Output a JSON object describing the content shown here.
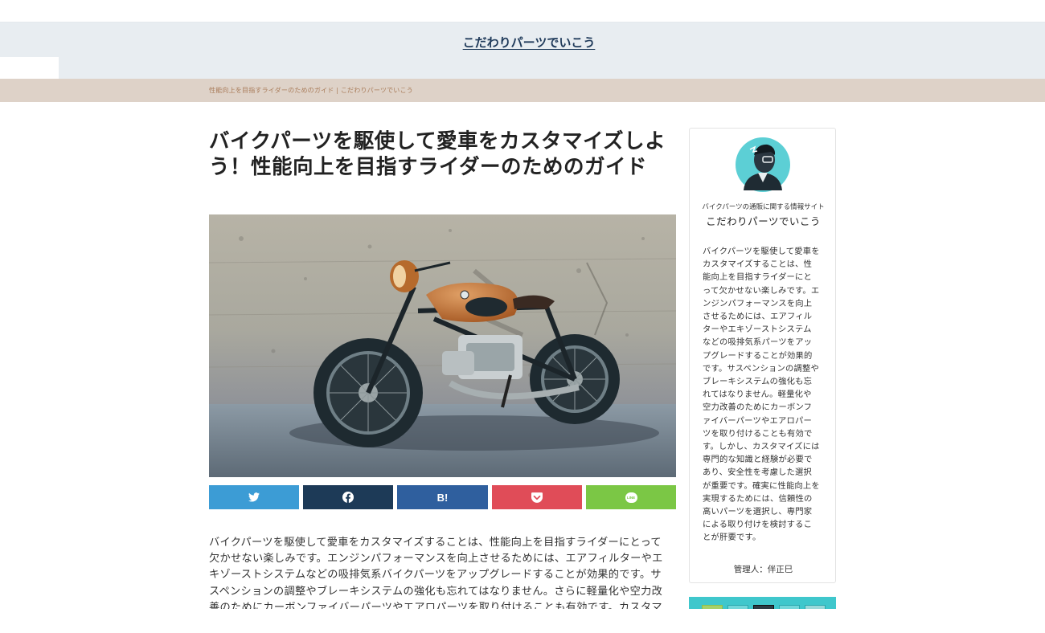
{
  "site": {
    "title": "こだわりパーツでいこう"
  },
  "breadcrumb": {
    "text": "性能向上を目指すライダーのためのガイド | こだわりパーツでいこう"
  },
  "article": {
    "title": "バイクパーツを駆使して愛車をカスタマイズしよう！性能向上を目指すライダーのためのガイド",
    "hero_image": "custom-motorcycle-photo",
    "body": "バイクパーツを駆使して愛車をカスタマイズすることは、性能向上を目指すライダーにとって欠かせない楽しみです。エンジンパフォーマンスを向上させるためには、エアフィルターやエキゾーストシステムなどの吸排気系バイクパーツをアップグレードすることが効果的です。サスペンションの調整やブレーキシステムの強化も忘れてはなりません。さらに軽量化や空力改善のためにカーボンファイバーパーツやエアロパーツを取り付けることも有効です。カスタマ"
  },
  "share": {
    "buttons": [
      {
        "icon": "twitter-icon",
        "color": "#3c9cd5"
      },
      {
        "icon": "facebook-icon",
        "color": "#1d3a57"
      },
      {
        "icon": "hatena-bookmark-icon",
        "label": "B!",
        "color": "#2f5f9e"
      },
      {
        "icon": "pocket-icon",
        "color": "#e04c58"
      },
      {
        "icon": "line-icon",
        "label": "LINE",
        "color": "#7bc745"
      }
    ]
  },
  "sidebar": {
    "profile": {
      "avatar": "avatar-illustration",
      "tagline": "バイクパーツの通販に関する情報サイト",
      "name": "こだわりパーツでいこう",
      "description": "バイクパーツを駆使して愛車をカスタマイズすることは、性能向上を目指すライダーにとって欠かせない楽しみです。エンジンパフォーマンスを向上させるためには、エアフィルターやエキゾーストシステムなどの吸排気系パーツをアップグレードすることが効果的です。サスペンションの調整やブレーキシステムの強化も忘れてはなりません。軽量化や空力改善のためにカーボンファイバーパーツやエアロパーツを取り付けることも有効です。しかし、カスタマイズには専門的な知識と経験が必要であり、安全性を考慮した選択が重要です。確実に性能向上を実現するためには、信頼性の高いパーツを選択し、専門家による取り付けを検討することが肝要です。",
      "admin": "管理人：伴正巳"
    }
  },
  "colors": {
    "header_bg": "#e8edf1",
    "breadcrumb_bg": "#ded2c8",
    "title_color": "#1f3a5a"
  }
}
